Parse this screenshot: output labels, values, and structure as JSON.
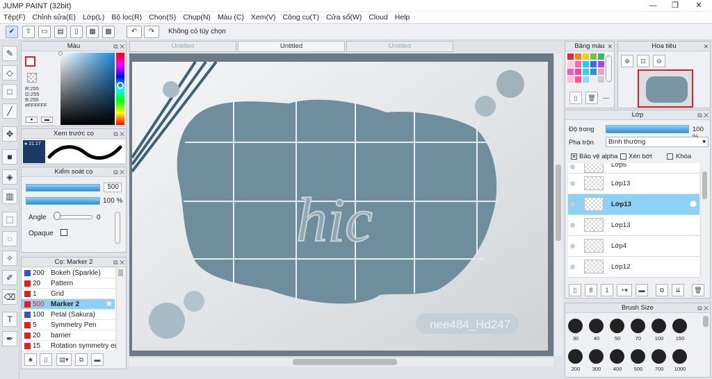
{
  "window": {
    "title": "JUMP PAINT (32bit)",
    "min": "—",
    "max": "❐",
    "close": "✕"
  },
  "menu": [
    "Tệp(F)",
    "Chỉnh sửa(E)",
    "Lớp(L)",
    "Bộ lọc(R)",
    "Chọn(S)",
    "Chụp(N)",
    "Màu (C)",
    "Xem(V)",
    "Công cụ(T)",
    "Cửa sổ(W)",
    "Cloud",
    "Help"
  ],
  "toolbar": {
    "option_text": "Không có tùy chọn"
  },
  "color_panel": {
    "title": "Màu",
    "r": "R:255",
    "g": "G:255",
    "b": "B:255",
    "hex": "#FFFFFF"
  },
  "preview_panel": {
    "title": "Xem trước cọ",
    "size": "21.17"
  },
  "brush_control": {
    "title": "Kiểm soát cọ",
    "size_value": "500",
    "opacity_value": "100 %",
    "angle_label": "Angle",
    "angle_value": "0",
    "opaque_label": "Opaque"
  },
  "brush_list": {
    "title": "Cọ: Marker 2",
    "items": [
      {
        "num": "200",
        "name": "Bokeh (Sparkle)",
        "color": "#3355cc"
      },
      {
        "num": "20",
        "name": "Pattern",
        "color": "#dd2222"
      },
      {
        "num": "1",
        "name": "Grid",
        "color": "#dd2222"
      },
      {
        "num": "500",
        "name": "Marker 2",
        "color": "#dd2222"
      },
      {
        "num": "100",
        "name": "Petal (Sakura)",
        "color": "#3355cc"
      },
      {
        "num": "5",
        "name": "Symmetry Pen",
        "color": "#dd2222"
      },
      {
        "num": "20",
        "name": "barrier",
        "color": "#dd2222"
      },
      {
        "num": "15",
        "name": "Rotation symmetry edg",
        "color": "#dd2222"
      }
    ]
  },
  "tabs": [
    "Untitled",
    "Untitled",
    "Untitled"
  ],
  "canvas": {
    "watermark": "nee484_Hd247",
    "text_art": "hic"
  },
  "swatch_panel": {
    "title": "Bảng màu",
    "more": "---"
  },
  "nav_panel": {
    "title": "Hoa tiêu"
  },
  "layer_panel": {
    "title": "Lớp",
    "opacity_label": "Độ trong",
    "opacity_value": "100 %",
    "blend_label": "Pha trộn",
    "blend_value": "Bình thường",
    "alpha_label": "Bảo vệ alpha",
    "clip_label": "Xén bớt",
    "lock_label": "Khóa",
    "layers": [
      "Lớp5",
      "Lớp13",
      "Lớp13",
      "Lớp13",
      "Lớp4",
      "Lớp12"
    ]
  },
  "brush_size": {
    "title": "Brush Size",
    "row1": [
      "30",
      "40",
      "50",
      "70",
      "100",
      "150"
    ],
    "row2": [
      "200",
      "300",
      "400",
      "500",
      "700",
      "1000"
    ]
  },
  "colors": {
    "accent": "#2b8fd9",
    "selection": "#8fd0f5",
    "canvas_blob": "#6f8e9d"
  }
}
